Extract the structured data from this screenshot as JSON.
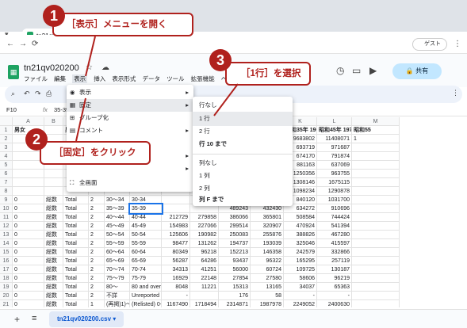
{
  "browser": {
    "tab_title": "tn21qv020200",
    "new_tab": "+",
    "guest_label": "ゲスト",
    "nav": {
      "back": "←",
      "forward": "→",
      "reload": "⟳",
      "home": "⌂"
    }
  },
  "app": {
    "doc_title": "tn21qv020200",
    "menus": [
      "ファイル",
      "編集",
      "表示",
      "挿入",
      "表示形式",
      "データ",
      "ツール",
      "拡張機能",
      "ヘルプ"
    ],
    "share_label": "共有"
  },
  "formula": {
    "cell_ref": "F10",
    "fx": "fx",
    "value": "35-39"
  },
  "view_menu": {
    "items": [
      {
        "label": "表示",
        "icon": "eye-icon",
        "arrow": true
      },
      {
        "label": "固定",
        "icon": "freeze-icon",
        "arrow": true
      },
      {
        "label": "グループ化",
        "icon": "group-icon",
        "arrow": false
      },
      {
        "label": "コメント",
        "icon": "comment-icon",
        "arrow": true
      },
      {
        "label": "",
        "icon": "",
        "arrow": true
      },
      {
        "label": "",
        "icon": "",
        "arrow": true
      },
      {
        "label": "全画面",
        "icon": "fullscreen-icon",
        "arrow": false
      }
    ]
  },
  "freeze_submenu": {
    "items": [
      "行なし",
      "1 行",
      "2 行",
      "行 10 まで",
      "列なし",
      "1 列",
      "2 列",
      "列 F まで"
    ]
  },
  "callouts": {
    "c1": {
      "num": "1",
      "text": "［表示］メニューを開く"
    },
    "c2": {
      "num": "2",
      "text": "［固定］をクリック"
    },
    "c3": {
      "num": "3",
      "text": "［1行］を選択"
    }
  },
  "grid": {
    "columns": [
      "",
      "A",
      "B",
      "C",
      "D",
      "E",
      "F",
      "G",
      "H",
      "I",
      "J",
      "K",
      "L",
      "M"
    ],
    "header_row": [
      "",
      "男女",
      "",
      "男女",
      "",
      "",
      "",
      "",
      "",
      "昭和15年 1940",
      "昭和25年 1950",
      "昭和35年 1960",
      "昭和45年 1970",
      "昭和55"
    ],
    "rows": [
      [
        "1",
        "男女",
        "",
        "男女",
        "",
        "",
        "",
        "",
        "",
        "昭和15年 1940",
        "昭和25年 1950",
        "昭和35年 1960",
        "昭和45年 1970",
        "昭和55"
      ],
      [
        "2",
        "",
        "",
        "",
        "",
        "",
        "",
        "",
        "",
        "7346983",
        "6277500",
        "9683802",
        "11408071",
        "1"
      ],
      [
        "3",
        "",
        "",
        "",
        "",
        "",
        "",
        "",
        "",
        "843200",
        "780018",
        "693719",
        "971687",
        ""
      ],
      [
        "4",
        "",
        "",
        "",
        "",
        "",
        "",
        "",
        "",
        "746468",
        "671135",
        "674170",
        "791874",
        ""
      ],
      [
        "5",
        "",
        "",
        "",
        "",
        "",
        "",
        "",
        "",
        "725203",
        "536825",
        "881163",
        "637069",
        ""
      ],
      [
        "6",
        "",
        "",
        "",
        "",
        "",
        "",
        "",
        "",
        "963479",
        "650609",
        "1250356",
        "963755",
        ""
      ],
      [
        "7",
        "",
        "",
        "",
        "",
        "",
        "",
        "",
        "",
        "789458",
        "693511",
        "1308146",
        "1675115",
        ""
      ],
      [
        "8",
        "",
        "",
        "",
        "",
        "",
        "",
        "",
        "",
        "726360",
        "567040",
        "1098234",
        "1290878",
        ""
      ],
      [
        "9",
        "0",
        "総数",
        "Total",
        "2",
        "30～34",
        "30-34",
        "",
        "",
        "588173",
        "465302",
        "840120",
        "1031700",
        ""
      ],
      [
        "10",
        "0",
        "総数",
        "Total",
        "2",
        "35～39",
        "35-39",
        "",
        "",
        "489243",
        "432430",
        "634272",
        "910696",
        ""
      ],
      [
        "11",
        "0",
        "総数",
        "Total",
        "2",
        "40～44",
        "40-44",
        "212729",
        "279858",
        "386066",
        "365801",
        "508584",
        "744424",
        ""
      ],
      [
        "12",
        "0",
        "総数",
        "Total",
        "2",
        "45～49",
        "45-49",
        "154983",
        "227066",
        "299514",
        "320907",
        "470924",
        "541394",
        ""
      ],
      [
        "13",
        "0",
        "総数",
        "Total",
        "2",
        "50～54",
        "50-54",
        "125606",
        "190982",
        "250083",
        "255876",
        "388826",
        "467280",
        ""
      ],
      [
        "14",
        "0",
        "総数",
        "Total",
        "2",
        "55～59",
        "55-59",
        "98477",
        "131262",
        "194737",
        "193039",
        "325046",
        "415597",
        ""
      ],
      [
        "15",
        "0",
        "総数",
        "Total",
        "2",
        "60～64",
        "60-64",
        "80349",
        "96218",
        "152213",
        "146358",
        "242579",
        "332866",
        ""
      ],
      [
        "16",
        "0",
        "総数",
        "Total",
        "2",
        "65～69",
        "65-69",
        "56287",
        "64286",
        "93437",
        "96322",
        "165295",
        "257119",
        ""
      ],
      [
        "17",
        "0",
        "総数",
        "Total",
        "2",
        "70～74",
        "70-74",
        "34313",
        "41251",
        "56000",
        "60724",
        "109725",
        "130187",
        ""
      ],
      [
        "18",
        "0",
        "総数",
        "Total",
        "2",
        "75～79",
        "75-79",
        "16929",
        "22148",
        "27854",
        "27580",
        "58606",
        "96219",
        ""
      ],
      [
        "19",
        "0",
        "総数",
        "Total",
        "2",
        "80～",
        "80 and over",
        "8048",
        "11221",
        "15313",
        "13165",
        "34037",
        "65363",
        ""
      ],
      [
        "20",
        "0",
        "総数",
        "Total",
        "2",
        "不詳",
        "Unreported",
        "-",
        "",
        "176",
        "58",
        "-",
        "-",
        ""
      ],
      [
        "21",
        "0",
        "総数",
        "Total",
        "1",
        "(再掲)1)～14",
        "(Relisted) 0-14",
        "1167490",
        "1718494",
        "2314871",
        "1987978",
        "2249052",
        "2400630",
        ""
      ],
      [
        "22",
        "0",
        "総数",
        "Total",
        "1",
        "(再掲)15～64",
        "(Relisted) 15-64",
        "2414374",
        "3551278",
        "4839332",
        "4090873",
        "7067087",
        "8416630",
        ""
      ]
    ]
  },
  "sheet_tab": "tn21qv020200.csv"
}
